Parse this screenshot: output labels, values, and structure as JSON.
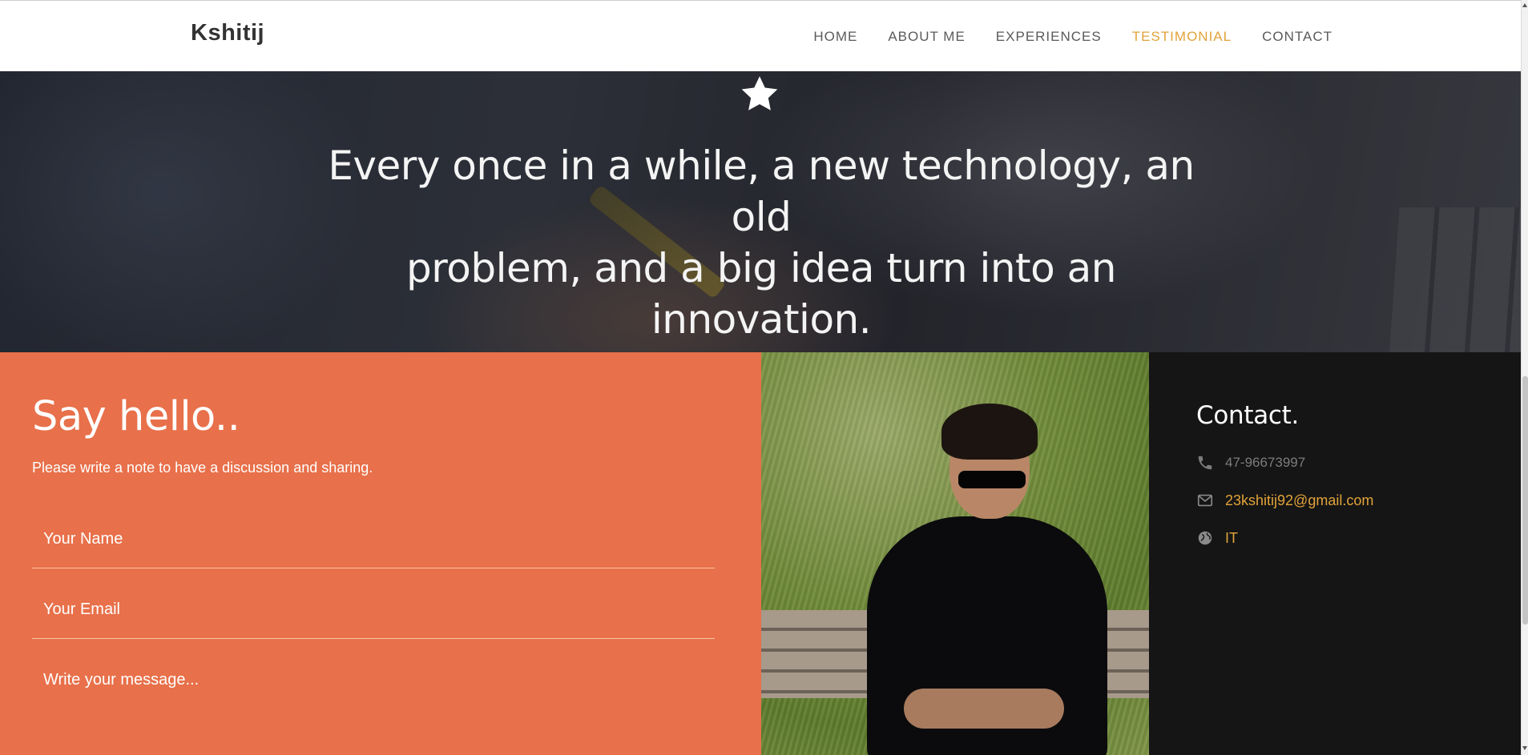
{
  "nav": {
    "brand": "Kshitij",
    "links": [
      {
        "label": "HOME",
        "active": false
      },
      {
        "label": "ABOUT ME",
        "active": false
      },
      {
        "label": "EXPERIENCES",
        "active": false
      },
      {
        "label": "TESTIMONIAL",
        "active": true
      },
      {
        "label": "CONTACT",
        "active": false
      }
    ]
  },
  "hero": {
    "icon": "star-icon",
    "quote_line1": "Every once in a while, a new technology, an old",
    "quote_line2": "problem, and a big idea turn into an innovation."
  },
  "form": {
    "title": "Say hello..",
    "subtitle": "Please write a note to have a discussion and sharing.",
    "name_placeholder": "Your Name",
    "email_placeholder": "Your Email",
    "message_placeholder": "Write your message..."
  },
  "contact": {
    "title": "Contact.",
    "phone": "47-96673997",
    "email": "23kshitij92@gmail.com",
    "website": "IT",
    "icons": [
      "phone-icon",
      "envelope-icon",
      "globe-icon"
    ]
  },
  "colors": {
    "accent": "#e2a33a",
    "form_bg": "#e8704a",
    "contact_bg": "#151515"
  }
}
